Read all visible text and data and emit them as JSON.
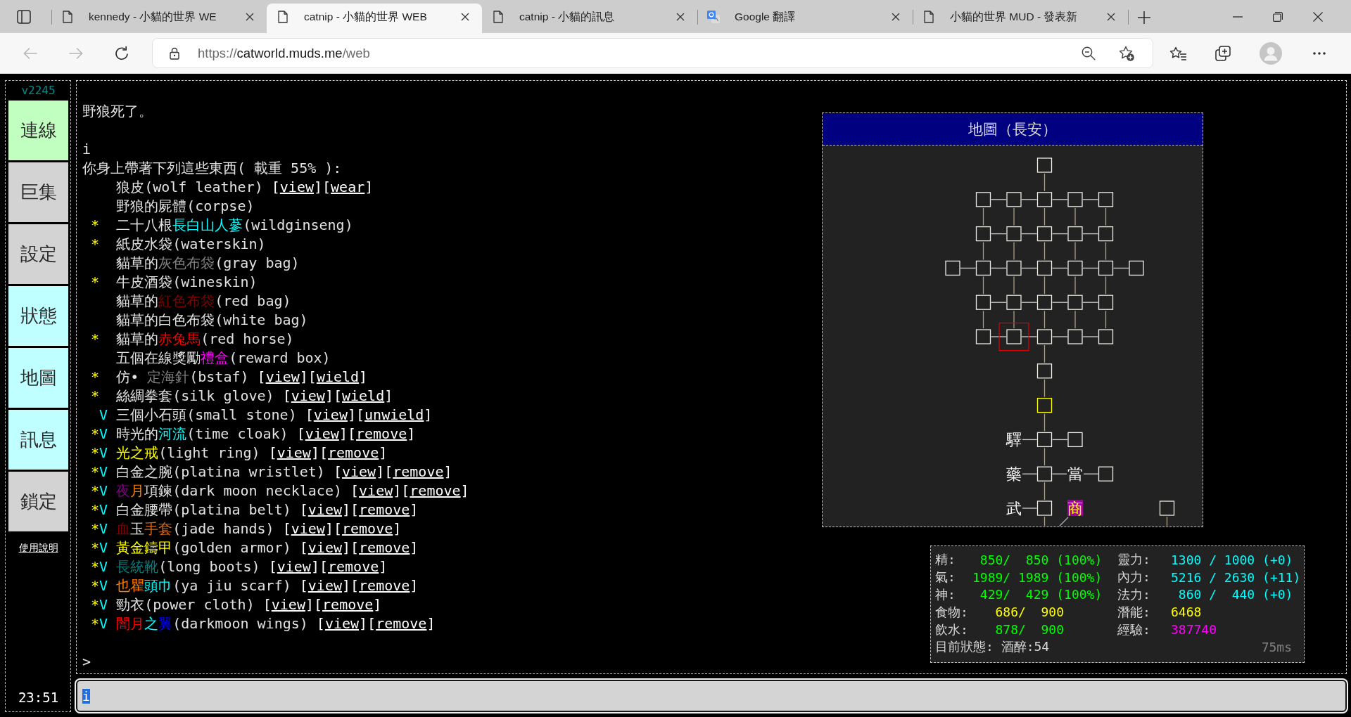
{
  "browser": {
    "tabs": [
      {
        "kind": "page",
        "title": "kennedy - 小貓的世界 WE",
        "selected": false
      },
      {
        "kind": "page",
        "title": "catnip - 小貓的世界 WEB",
        "selected": true
      },
      {
        "kind": "page",
        "title": "catnip - 小貓的訊息",
        "selected": false
      },
      {
        "kind": "translate",
        "title": "Google 翻譯",
        "selected": false
      },
      {
        "kind": "page",
        "title": "小貓的世界 MUD - 發表新",
        "selected": false
      }
    ],
    "address": {
      "scheme": "https://",
      "host": "catworld.muds.me",
      "path": "/web"
    }
  },
  "sidebar": {
    "version": "v2245",
    "buttons": [
      {
        "label": "連線",
        "color": "#c0ffc0"
      },
      {
        "label": "巨集",
        "color": "#d3d3d3"
      },
      {
        "label": "設定",
        "color": "#d3d3d3"
      },
      {
        "label": "狀態",
        "color": "#c0ffff"
      },
      {
        "label": "地圖",
        "color": "#c0ffff"
      },
      {
        "label": "訊息",
        "color": "#c0ffff"
      },
      {
        "label": "鎖定",
        "color": "#d3d3d3"
      }
    ],
    "help_link": "使用說明",
    "clock": "23:51"
  },
  "output": {
    "lines": [
      {
        "kind": "text",
        "text": "野狼死了。"
      },
      {
        "kind": "blank"
      },
      {
        "kind": "command",
        "text": "i"
      },
      {
        "kind": "text",
        "text": "你身上帶著下列這些東西( 載重 55% ):"
      },
      {
        "kind": "item",
        "name": [
          {
            "text": "狼皮(wolf leather)"
          }
        ],
        "actions": [
          {
            "open": "[",
            "label": "view",
            "close": "]"
          },
          {
            "open": "[",
            "label": "wear",
            "close": "]"
          }
        ]
      },
      {
        "kind": "item",
        "name": [
          {
            "text": "野狼的屍體(corpse)"
          }
        ]
      },
      {
        "kind": "item",
        "star_mark": "*",
        "name": [
          {
            "text": "二十八根"
          },
          {
            "text": "長白山人蔘",
            "color": "#00ffff"
          },
          {
            "text": "(wildginseng)"
          }
        ]
      },
      {
        "kind": "item",
        "star_mark": "*",
        "name": [
          {
            "text": "紙皮水袋(waterskin)"
          }
        ]
      },
      {
        "kind": "item",
        "name": [
          {
            "text": "貓草的"
          },
          {
            "text": "灰色布袋",
            "color": "#808080"
          },
          {
            "text": "(gray bag)"
          }
        ]
      },
      {
        "kind": "item",
        "star_mark": "*",
        "name": [
          {
            "text": "牛皮酒袋(wineskin)"
          }
        ]
      },
      {
        "kind": "item",
        "name": [
          {
            "text": "貓草的"
          },
          {
            "text": "紅色布袋",
            "color": "#800000"
          },
          {
            "text": "(red bag)"
          }
        ]
      },
      {
        "kind": "item",
        "name": [
          {
            "text": "貓草的白色布袋(white bag)"
          }
        ]
      },
      {
        "kind": "item",
        "star_mark": "*",
        "name": [
          {
            "text": "貓草的"
          },
          {
            "text": "赤兔馬",
            "color": "#ff0000"
          },
          {
            "text": "(red horse)"
          }
        ]
      },
      {
        "kind": "item",
        "name": [
          {
            "text": "五個在線獎勵"
          },
          {
            "text": "禮盒",
            "color": "#ff00ff"
          },
          {
            "text": "(reward box)"
          }
        ]
      },
      {
        "kind": "item",
        "star_mark": "*",
        "name": [
          {
            "text": "仿• "
          },
          {
            "text": "定海針",
            "color": "#808080"
          },
          {
            "text": "(bstaf)"
          }
        ],
        "actions": [
          {
            "open": "[",
            "label": "view",
            "close": "]"
          },
          {
            "open": "[",
            "label": "wield",
            "close": "]"
          }
        ]
      },
      {
        "kind": "item",
        "star_mark": "*",
        "name": [
          {
            "text": "絲綢拳套(silk glove)"
          }
        ],
        "actions": [
          {
            "open": "[",
            "label": "view",
            "close": "]"
          },
          {
            "open": "[",
            "label": "wield",
            "close": "]"
          }
        ]
      },
      {
        "kind": "item",
        "equip_mark": "V",
        "name": [
          {
            "text": "三個小石頭(small stone)"
          }
        ],
        "actions": [
          {
            "open": "[",
            "label": "view",
            "close": "]"
          },
          {
            "open": "[",
            "label": "unwield",
            "close": "]"
          }
        ]
      },
      {
        "kind": "item",
        "star_mark": "*",
        "equip_mark": "V",
        "name": [
          {
            "text": "時光的"
          },
          {
            "text": "河流",
            "color": "#00ffff"
          },
          {
            "text": "(time cloak)"
          }
        ],
        "actions": [
          {
            "open": "[",
            "label": "view",
            "close": "]"
          },
          {
            "open": "[",
            "label": "remove",
            "close": "]"
          }
        ]
      },
      {
        "kind": "item",
        "star_mark": "*",
        "equip_mark": "V",
        "name": [
          {
            "text": "光之戒",
            "color": "#ffff00"
          },
          {
            "text": "(light ring)"
          }
        ],
        "actions": [
          {
            "open": "[",
            "label": "view",
            "close": "]"
          },
          {
            "open": "[",
            "label": "remove",
            "close": "]"
          }
        ]
      },
      {
        "kind": "item",
        "star_mark": "*",
        "equip_mark": "V",
        "name": [
          {
            "text": "白金之腕(platina wristlet)"
          }
        ],
        "actions": [
          {
            "open": "[",
            "label": "view",
            "close": "]"
          },
          {
            "open": "[",
            "label": "remove",
            "close": "]"
          }
        ]
      },
      {
        "kind": "item",
        "star_mark": "*",
        "equip_mark": "V",
        "name": [
          {
            "text": "夜",
            "color": "#800080"
          },
          {
            "text": "月",
            "color": "#ff8000"
          },
          {
            "text": "項鍊(dark moon necklace)"
          }
        ],
        "actions": [
          {
            "open": "[",
            "label": "view",
            "close": "]"
          },
          {
            "open": "[",
            "label": "remove",
            "close": "]"
          }
        ]
      },
      {
        "kind": "item",
        "star_mark": "*",
        "equip_mark": "V",
        "name": [
          {
            "text": "白金腰帶(platina belt)"
          }
        ],
        "actions": [
          {
            "open": "[",
            "label": "view",
            "close": "]"
          },
          {
            "open": "[",
            "label": "remove",
            "close": "]"
          }
        ]
      },
      {
        "kind": "item",
        "star_mark": "*",
        "equip_mark": "V",
        "name": [
          {
            "text": "血",
            "color": "#800000"
          },
          {
            "text": "玉"
          },
          {
            "text": "手套",
            "color": "#d2691e"
          },
          {
            "text": "(jade hands)"
          }
        ],
        "actions": [
          {
            "open": "[",
            "label": "view",
            "close": "]"
          },
          {
            "open": "[",
            "label": "remove",
            "close": "]"
          }
        ]
      },
      {
        "kind": "item",
        "star_mark": "*",
        "equip_mark": "V",
        "name": [
          {
            "text": "黃金鑄甲",
            "color": "#ffff00"
          },
          {
            "text": "(golden armor)"
          }
        ],
        "actions": [
          {
            "open": "[",
            "label": "view",
            "close": "]"
          },
          {
            "open": "[",
            "label": "remove",
            "close": "]"
          }
        ]
      },
      {
        "kind": "item",
        "star_mark": "*",
        "equip_mark": "V",
        "name": [
          {
            "text": "長統靴",
            "color": "#008080"
          },
          {
            "text": "(long boots)"
          }
        ],
        "actions": [
          {
            "open": "[",
            "label": "view",
            "close": "]"
          },
          {
            "open": "[",
            "label": "remove",
            "close": "]"
          }
        ]
      },
      {
        "kind": "item",
        "star_mark": "*",
        "equip_mark": "V",
        "name": [
          {
            "text": "也瞿",
            "color": "#ff8000"
          },
          {
            "text": "頭巾",
            "color": "#00ffff"
          },
          {
            "text": "(ya jiu scarf)"
          }
        ],
        "actions": [
          {
            "open": "[",
            "label": "view",
            "close": "]"
          },
          {
            "open": "[",
            "label": "remove",
            "close": "]"
          }
        ]
      },
      {
        "kind": "item",
        "star_mark": "*",
        "equip_mark": "V",
        "name": [
          {
            "text": "勁衣(power cloth)"
          }
        ],
        "actions": [
          {
            "open": "[",
            "label": "view",
            "close": "]"
          },
          {
            "open": "[",
            "label": "remove",
            "close": "]"
          }
        ]
      },
      {
        "kind": "item",
        "star_mark": "*",
        "equip_mark": "V",
        "name": [
          {
            "text": "闇月",
            "color": "#ff0000"
          },
          {
            "text": "之",
            "color": "#00ffff"
          },
          {
            "text": "翼",
            "color": "#0000ff"
          },
          {
            "text": "(darkmoon wings)"
          }
        ],
        "actions": [
          {
            "open": "[",
            "label": "view",
            "close": "]"
          },
          {
            "open": "[",
            "label": "remove",
            "close": "]"
          }
        ]
      },
      {
        "kind": "blank"
      },
      {
        "kind": "prompt",
        "text": ">"
      }
    ]
  },
  "map": {
    "title": "地圖（長安）",
    "rows": [
      {
        "cells": [
          null,
          null,
          null,
          {
            "kind": "room",
            "south": true,
            "current": false
          }
        ]
      },
      {
        "cells": [
          null,
          {
            "kind": "room",
            "east": true,
            "south": true,
            "current": false
          },
          {
            "kind": "room",
            "east": true,
            "south": true,
            "current": false
          },
          {
            "kind": "room",
            "east": true,
            "south": true,
            "current": false
          },
          {
            "kind": "room",
            "east": true,
            "south": true,
            "current": false
          },
          {
            "kind": "room",
            "south": true,
            "current": false
          }
        ]
      },
      {
        "cells": [
          null,
          {
            "kind": "room",
            "east": true,
            "south": true,
            "current": false
          },
          {
            "kind": "room",
            "east": true,
            "south": true,
            "current": false
          },
          {
            "kind": "room",
            "east": true,
            "south": true,
            "current": false
          },
          {
            "kind": "room",
            "east": true,
            "south": true,
            "current": false
          },
          {
            "kind": "room",
            "south": true,
            "current": false
          }
        ]
      },
      {
        "cells": [
          {
            "kind": "room",
            "east": true,
            "current": false
          },
          {
            "kind": "room",
            "east": true,
            "south": true,
            "current": false
          },
          {
            "kind": "room",
            "east": true,
            "south": true,
            "current": false
          },
          {
            "kind": "room",
            "east": true,
            "south": true,
            "current": false
          },
          {
            "kind": "room",
            "east": true,
            "south": true,
            "current": false
          },
          {
            "kind": "room",
            "east": true,
            "south": true,
            "current": false
          },
          {
            "kind": "room",
            "current": false
          }
        ]
      },
      {
        "cells": [
          null,
          {
            "kind": "room",
            "east": true,
            "south": true,
            "current": false
          },
          {
            "kind": "room",
            "east": true,
            "south": true,
            "current": false
          },
          {
            "kind": "room",
            "east": true,
            "south": true,
            "current": false
          },
          {
            "kind": "room",
            "east": true,
            "south": true,
            "current": false
          },
          {
            "kind": "room",
            "south": true,
            "current": false
          }
        ]
      },
      {
        "cells": [
          null,
          {
            "kind": "room",
            "east": true,
            "current": false
          },
          {
            "kind": "room",
            "east": true,
            "current": true
          },
          {
            "kind": "room",
            "east": true,
            "south": true,
            "current": false
          },
          {
            "kind": "room",
            "east": true,
            "current": false
          },
          {
            "kind": "room",
            "current": false
          }
        ]
      },
      {
        "cells": [
          null,
          null,
          null,
          {
            "kind": "room",
            "south": true,
            "current": false
          }
        ]
      },
      {
        "cells": [
          null,
          null,
          null,
          {
            "kind": "room",
            "south": true,
            "current": false,
            "color": "#ffff00"
          }
        ]
      },
      {
        "cells": [
          null,
          null,
          {
            "kind": "label",
            "text": "驛",
            "east": true
          },
          {
            "kind": "room",
            "east": true,
            "south": true,
            "current": false
          },
          {
            "kind": "room",
            "current": false
          }
        ]
      },
      {
        "cells": [
          null,
          null,
          {
            "kind": "label",
            "text": "藥",
            "east": true
          },
          {
            "kind": "room",
            "east": true,
            "south": true,
            "current": false
          },
          {
            "kind": "label",
            "text": "當",
            "east": true
          },
          {
            "kind": "room",
            "current": false
          }
        ]
      },
      {
        "cells": [
          null,
          null,
          {
            "kind": "label",
            "text": "武",
            "east": true
          },
          {
            "kind": "room",
            "south": true,
            "current": false
          },
          {
            "kind": "shop",
            "text": "商",
            "southwest": true
          },
          null,
          null,
          {
            "kind": "room",
            "south": true,
            "current": false
          }
        ]
      }
    ]
  },
  "stats": {
    "rows": [
      {
        "left": {
          "label": "精:",
          "value": " 850/  850 (100%)",
          "color": "#00ff00"
        },
        "right": {
          "label": "靈力:",
          "value": "1300 / 1000 (+0)",
          "color": "#00ffff"
        }
      },
      {
        "left": {
          "label": "氣:",
          "value": "1989/ 1989 (100%)",
          "color": "#00ff00"
        },
        "right": {
          "label": "內力:",
          "value": "5216 / 2630 (+11)",
          "color": "#00ffff"
        }
      },
      {
        "left": {
          "label": "神:",
          "value": " 429/  429 (100%)",
          "color": "#00ff00"
        },
        "right": {
          "label": "法力:",
          "value": " 860 /  440 (+0)",
          "color": "#00ffff"
        }
      },
      {
        "left": {
          "label": "食物:",
          "value": "   686/  900",
          "color": "#ffff00"
        },
        "right": {
          "label": "潛能:",
          "value": "6468",
          "color": "#ffff00"
        }
      },
      {
        "left": {
          "label": "飲水:",
          "value": "   878/  900",
          "color": "#00ff00"
        },
        "right": {
          "label": "經驗:",
          "value": "387740",
          "color": "#ff00ff"
        }
      }
    ],
    "status": {
      "label": "目前狀態:",
      "value": "酒醉:54"
    },
    "latency": "75ms"
  },
  "command": {
    "value": "i",
    "value_selected": true
  }
}
